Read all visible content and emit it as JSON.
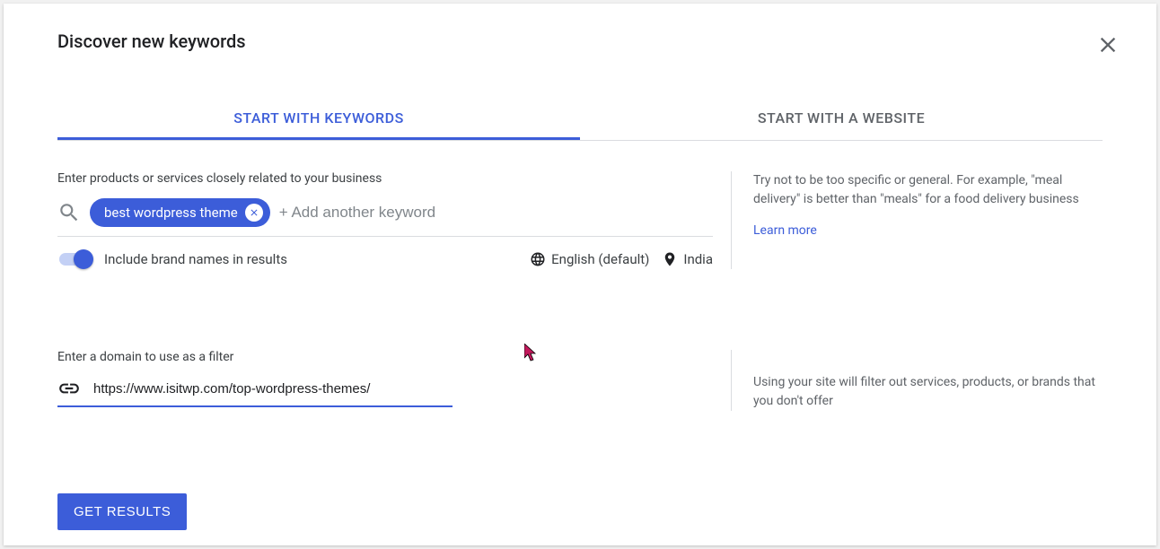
{
  "header": {
    "title": "Discover new keywords"
  },
  "tabs": {
    "keywords": "START WITH KEYWORDS",
    "website": "START WITH A WEBSITE"
  },
  "keywords_section": {
    "label": "Enter products or services closely related to your business",
    "chip_text": "best wordpress theme",
    "add_placeholder": "+ Add another keyword",
    "toggle_label": "Include brand names in results",
    "language": "English (default)",
    "location": "India"
  },
  "help": {
    "keywords_tip": "Try not to be too specific or general. For example, \"meal delivery\" is better than \"meals\" for a food delivery business",
    "learn_more": "Learn more",
    "domain_tip": "Using your site will filter out services, products, or brands that you don't offer"
  },
  "filter_section": {
    "label": "Enter a domain to use as a filter",
    "domain_value": "https://www.isitwp.com/top-wordpress-themes/"
  },
  "actions": {
    "get_results": "GET RESULTS"
  }
}
